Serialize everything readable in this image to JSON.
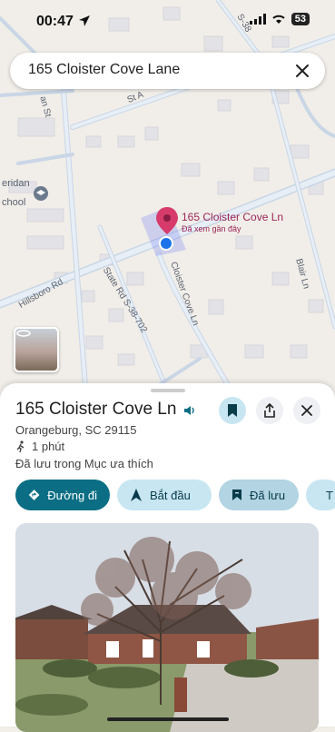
{
  "status_bar": {
    "time": "00:47",
    "battery": "53",
    "icons": [
      "location-arrow-icon",
      "signal-icon",
      "wifi-icon",
      "battery-icon"
    ]
  },
  "search": {
    "query": "165 Cloister Cove Lane",
    "close_icon": "close-icon"
  },
  "map": {
    "pin_title": "165 Cloister Cove Ln",
    "pin_subtitle": "Đã xem gần đây",
    "road_labels": {
      "hillsboro": "Hillsboro Rd",
      "state_rd": "State Rd S-38-702",
      "cloister": "Cloister Cove Ln",
      "blair": "Blair Ln",
      "st_top": "St A",
      "an_st": "an St",
      "s38": "S-38",
      "school_1": "eridan",
      "school_2": "chool"
    },
    "colors": {
      "pin": "#d63b6b",
      "pin_label": "#9c2557",
      "location_dot": "#1a73e8",
      "road": "#c8d6e6"
    }
  },
  "sheet": {
    "title": "165 Cloister Cove Ln",
    "address": "Orangeburg, SC 29115",
    "walk_time": "1 phút",
    "saved_note": "Đã lưu trong Mục ưa thích",
    "actions": [
      {
        "label": "Đường đi",
        "icon": "directions-icon"
      },
      {
        "label": "Bắt đầu",
        "icon": "navigation-arrow-icon"
      },
      {
        "label": "Đã lưu",
        "icon": "bookmark-icon"
      },
      {
        "label": "T",
        "icon": "flag-icon"
      }
    ],
    "colors": {
      "primary": "#0b6e84",
      "chip_bg": "#c8e6f2",
      "chip_text": "#073b4a"
    }
  }
}
